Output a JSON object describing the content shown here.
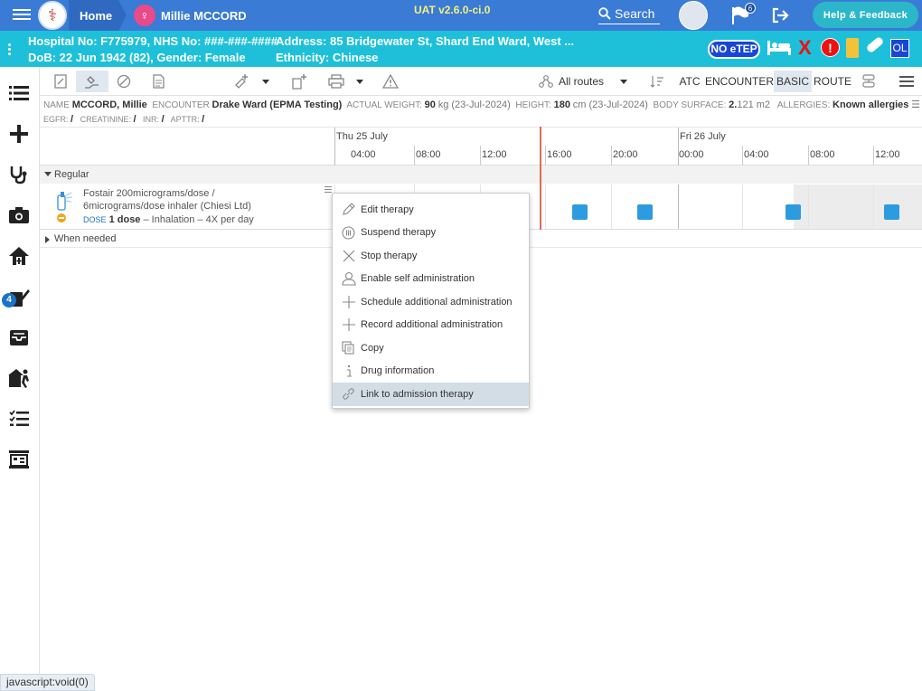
{
  "topbar": {
    "home_label": "Home",
    "patient_label": "Millie MCCORD",
    "version": "UAT v2.6.0-ci.0",
    "search_label": "Search",
    "flag_count": "6",
    "help_label": "Help & Feedback",
    "accent": "#3a7bd5"
  },
  "banner": {
    "line1_left": "Hospital No: F775979, NHS No: ###-###-####",
    "line2_left": "DoB: 22 Jun 1942 (82), Gender: Female",
    "line1_right": "Address: 85 Bridgewater St, Shard End Ward, West ...",
    "line2_right": "Ethnicity: Chinese",
    "no_etep": "NO eTEP",
    "red_x": "X",
    "alert": "!",
    "ol": "OL",
    "color": "#1ec0d9"
  },
  "sidebar": {
    "badge_count": "4",
    "items": [
      "list-icon",
      "plus-icon",
      "stethoscope-icon",
      "camera-icon",
      "home-care-icon",
      "prescribe-icon",
      "inbox-icon",
      "discharge-icon",
      "checklist-icon",
      "report-icon"
    ]
  },
  "toolbar": {
    "routes_label": "All routes",
    "atc": "ATC",
    "encounter": "ENCOUNTER",
    "basic": "BASIC",
    "route": "ROUTE"
  },
  "info": {
    "name_lbl": "NAME",
    "name": "MCCORD, Millie",
    "encounter_lbl": "ENCOUNTER",
    "encounter": "Drake Ward (EPMA Testing)",
    "weight_lbl": "ACTUAL WEIGHT",
    "weight": "90",
    "weight_unit": "kg (23-Jul-2024)",
    "height_lbl": "HEIGHT",
    "height": "180",
    "height_unit": "cm (23-Jul-2024)",
    "bsa_lbl": "BODY SURFACE",
    "bsa": "2.",
    "bsa_rest": "121 m2",
    "allergies_lbl": "ALLERGIES",
    "allergies": "Known allergies",
    "egfr_lbl": "EGFR:",
    "egfr": "/",
    "creat_lbl": "CREATININE:",
    "creat": "/",
    "inr_lbl": "INR:",
    "inr": "/",
    "apttr_lbl": "APTTR:",
    "apttr": "/"
  },
  "timeline": {
    "day1": "Thu 25 July",
    "day2": "Fri 26 July",
    "hours": [
      "04:00",
      "08:00",
      "12:00",
      "16:00",
      "20:00",
      "00:00",
      "04:00",
      "08:00",
      "12:00"
    ]
  },
  "sections": {
    "regular": "Regular",
    "when_needed": "When needed"
  },
  "drug": {
    "name_line1": "Fostair 200micrograms/dose /",
    "name_line2": "6micrograms/dose inhaler (Chiesi Ltd)",
    "dose_lbl": "DOSE",
    "dose": "1 dose",
    "dose_rest": "– Inhalation – 4X per day",
    "dose_color": "#2d9bdf"
  },
  "context_menu": {
    "items": [
      {
        "label": "Edit therapy",
        "icon": "pencil-icon"
      },
      {
        "label": "Suspend therapy",
        "icon": "pause-circle-icon"
      },
      {
        "label": "Stop therapy",
        "icon": "x-icon"
      },
      {
        "label": "Enable self administration",
        "icon": "person-icon"
      },
      {
        "label": "Schedule additional administration",
        "icon": "plus-icon"
      },
      {
        "label": "Record additional administration",
        "icon": "plus-icon"
      },
      {
        "label": "Copy",
        "icon": "copy-icon"
      },
      {
        "label": "Drug information",
        "icon": "info-icon"
      },
      {
        "label": "Link to admission therapy",
        "icon": "link-icon"
      }
    ]
  },
  "statusbar": "javascript:void(0)"
}
